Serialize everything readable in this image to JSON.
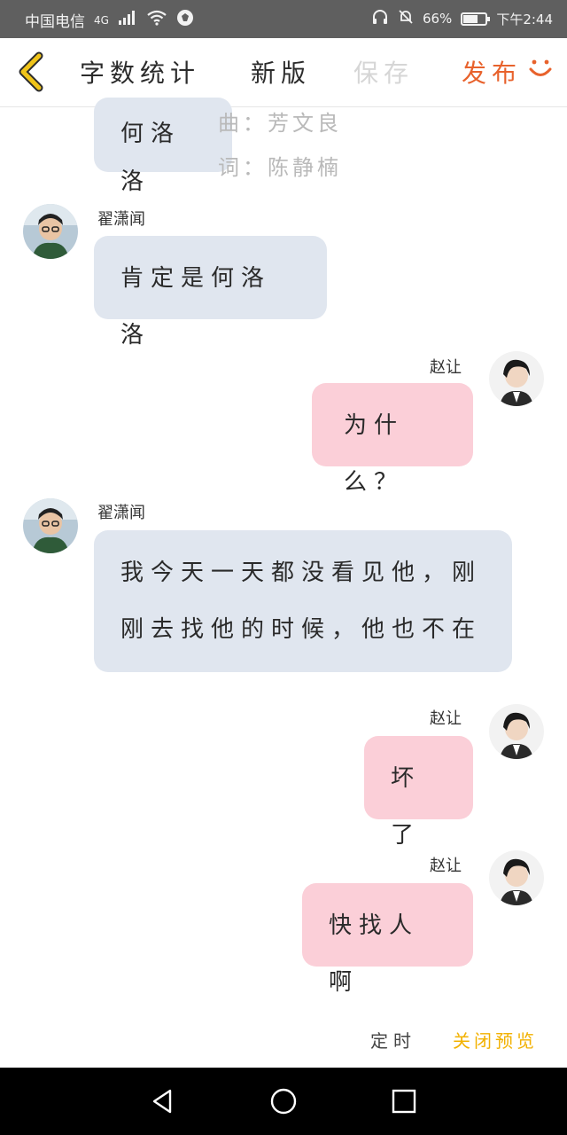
{
  "status_bar": {
    "carrier": "中国电信",
    "network": "4G",
    "battery": "66%",
    "battery_level": 0.66,
    "time": "下午2:44"
  },
  "toolbar": {
    "stats_label": "字数统计",
    "new_label": "新版",
    "save_label": "保存",
    "publish_label": "发布"
  },
  "credits": {
    "composer": "曲：芳文良",
    "lyricist": "词：陈静楠"
  },
  "messages": [
    {
      "side": "left",
      "name": "",
      "text": "何洛洛"
    },
    {
      "side": "left",
      "name": "翟潇闻",
      "text": "肯定是何洛洛"
    },
    {
      "side": "right",
      "name": "赵让",
      "text": "为什么？"
    },
    {
      "side": "left",
      "name": "翟潇闻",
      "text": "我今天一天都没看见他，刚刚去找他的时候，他也不在"
    },
    {
      "side": "right",
      "name": "赵让",
      "text": "坏了"
    },
    {
      "side": "right",
      "name": "赵让",
      "text": "快找人啊"
    }
  ],
  "bottom": {
    "timer_label": "定时",
    "close_preview_label": "关闭预览"
  },
  "colors": {
    "left_bubble": "#e0e6ef",
    "right_bubble": "#fbcfd8",
    "publish": "#e8622c",
    "close_preview": "#f2b100",
    "back_arrow": "#f0c419"
  }
}
